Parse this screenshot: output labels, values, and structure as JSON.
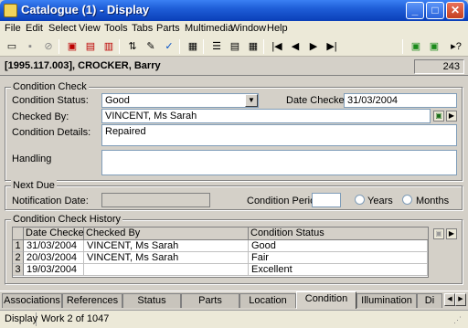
{
  "window": {
    "title": "Catalogue (1) - Display",
    "minimize": "_",
    "maximize": "□",
    "close": "✕"
  },
  "menu": [
    "File",
    "Edit",
    "Select",
    "View",
    "Tools",
    "Tabs",
    "Parts",
    "Multimedia",
    "Window",
    "Help"
  ],
  "toolbar": {
    "icons": [
      "new-icon",
      "save-icon",
      "disabled-icon",
      "new-record-icon",
      "delete-record-icon",
      "copy-record-icon",
      "sort-icon",
      "edit-icon",
      "spellcheck-icon",
      "report-icon",
      "list-view-icon",
      "detail-view-icon",
      "page-view-icon",
      "first-icon",
      "prev-icon",
      "next-icon",
      "last-icon",
      "attach-icon",
      "detach-icon",
      "help-icon"
    ]
  },
  "record": {
    "title": "[1995.117.003], CROCKER, Barry",
    "count": "243"
  },
  "condition_check": {
    "group_title": "Condition Check",
    "status_label": "Condition Status:",
    "status_value": "Good",
    "date_checked_label": "Date Checked:",
    "date_checked_value": "31/03/2004",
    "checked_by_label": "Checked By:",
    "checked_by_value": "VINCENT, Ms Sarah",
    "details_label": "Condition Details:",
    "details_value": "Repaired",
    "handling_label": "Handling",
    "handling_value": ""
  },
  "next_due": {
    "group_title": "Next Due",
    "notification_label": "Notification Date:",
    "notification_value": "",
    "period_label": "Condition Period:",
    "period_value": "",
    "years_label": "Years",
    "months_label": "Months"
  },
  "history": {
    "group_title": "Condition Check History",
    "columns": [
      "Date Checked",
      "Checked By",
      "Condition Status"
    ],
    "rows": [
      {
        "n": "1",
        "date": "31/03/2004",
        "by": "VINCENT, Ms Sarah",
        "status": "Good"
      },
      {
        "n": "2",
        "date": "20/03/2004",
        "by": "VINCENT, Ms Sarah",
        "status": "Fair"
      },
      {
        "n": "3",
        "date": "19/03/2004",
        "by": "",
        "status": "Excellent"
      }
    ]
  },
  "tabs": [
    "Associations",
    "References",
    "Status",
    "Parts",
    "Location",
    "Condition",
    "Illumination",
    "Di"
  ],
  "active_tab": "Condition",
  "status": {
    "mode": "Display",
    "position": "Work 2 of 1047"
  },
  "colors": {
    "title_bar": "#1f5ed8",
    "face": "#d4d0c8",
    "menu": "#ece9d8"
  }
}
